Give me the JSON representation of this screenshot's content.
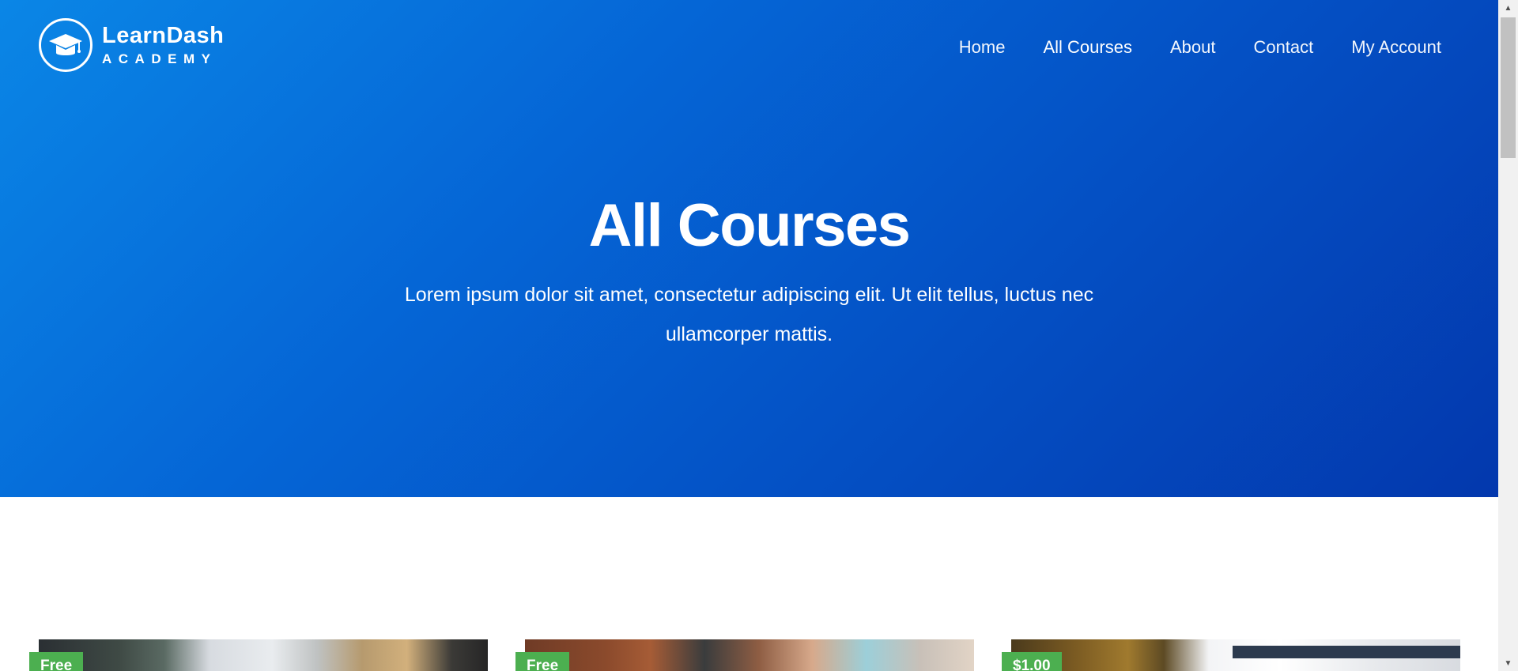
{
  "logo": {
    "name": "LearnDash",
    "subtitle": "ACADEMY",
    "icon": "graduation-cap-icon"
  },
  "nav": {
    "items": [
      {
        "label": "Home"
      },
      {
        "label": "All Courses"
      },
      {
        "label": "About"
      },
      {
        "label": "Contact"
      },
      {
        "label": "My Account"
      }
    ]
  },
  "hero": {
    "title": "All Courses",
    "subtitle": "Lorem ipsum dolor sit amet, consectetur adipiscing elit. Ut elit tellus, luctus nec ullamcorper mattis."
  },
  "courses": [
    {
      "price": "Free"
    },
    {
      "price": "Free"
    },
    {
      "price": "$1.00"
    }
  ],
  "colors": {
    "hero_gradient_start": "#0a86e6",
    "hero_gradient_end": "#0338ad",
    "badge_green": "#4caf50"
  }
}
